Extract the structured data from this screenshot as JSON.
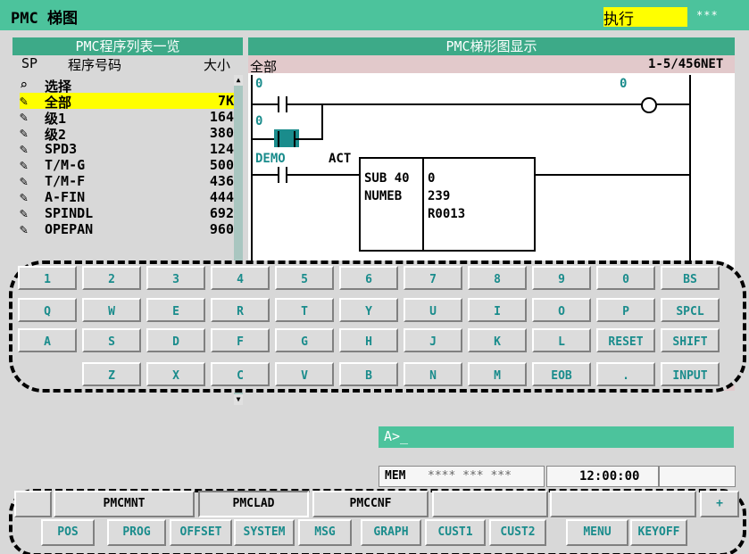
{
  "header": {
    "title": "PMC 梯图",
    "mode": "执行",
    "stars": "***"
  },
  "list_panel": {
    "title": "PMC程序列表一览",
    "col_sp": "SP",
    "col_program": "程序号码",
    "col_size": "大小",
    "rows": [
      {
        "icon": "search",
        "name": "选择",
        "size": ""
      },
      {
        "icon": "pencil",
        "name": "全部",
        "size": "7K"
      },
      {
        "icon": "pencil",
        "name": "级1",
        "size": "164"
      },
      {
        "icon": "pencil",
        "name": "级2",
        "size": "380"
      },
      {
        "icon": "pencil",
        "name": "SPD3",
        "size": "124"
      },
      {
        "icon": "pencil",
        "name": "T/M-G",
        "size": "500"
      },
      {
        "icon": "pencil",
        "name": "T/M-F",
        "size": "436"
      },
      {
        "icon": "pencil",
        "name": "A-FIN",
        "size": "444"
      },
      {
        "icon": "pencil",
        "name": "SPINDL",
        "size": "692"
      },
      {
        "icon": "pencil",
        "name": "OPEPAN",
        "size": "960"
      }
    ]
  },
  "ladder": {
    "title": "PMC梯形图显示",
    "program": "全部",
    "position": "1-5/456NET",
    "r1_left": "0",
    "r1_coil": "0",
    "r2_left": "0",
    "r3_sig1": "DEMO",
    "r3_sig2": "ACT",
    "func_label1": "SUB 40",
    "func_label2": "NUMEB",
    "func_v1": "0",
    "func_v2": "239",
    "func_v3": "R0013"
  },
  "keyboard": {
    "row1": [
      "1",
      "2",
      "3",
      "4",
      "5",
      "6",
      "7",
      "8",
      "9",
      "0",
      "BS"
    ],
    "row2": [
      "Q",
      "W",
      "E",
      "R",
      "T",
      "Y",
      "U",
      "I",
      "O",
      "P",
      "SPCL"
    ],
    "row3": [
      "A",
      "S",
      "D",
      "F",
      "G",
      "H",
      "J",
      "K",
      "L",
      "RESET",
      "SHIFT"
    ],
    "row4": [
      "Z",
      "X",
      "C",
      "V",
      "B",
      "N",
      "M",
      "EOB",
      ".",
      "INPUT"
    ]
  },
  "command": {
    "prompt": "A>_"
  },
  "status": {
    "mode": "MEM",
    "stars": "**** *** ***",
    "time": "12:00:00"
  },
  "softkeys": {
    "upper": [
      "PMCMNT",
      "PMCLAD",
      "PMCCNF",
      "+"
    ],
    "lower": [
      "POS",
      "PROG",
      "OFFSET",
      "SYSTEM",
      "MSG",
      "GRAPH",
      "CUST1",
      "CUST2",
      "MENU",
      "KEYOFF"
    ]
  },
  "colors": {
    "title_bg": "#4cc39c",
    "highlight": "#ffff00",
    "accent_text": "#1a8c8c"
  }
}
